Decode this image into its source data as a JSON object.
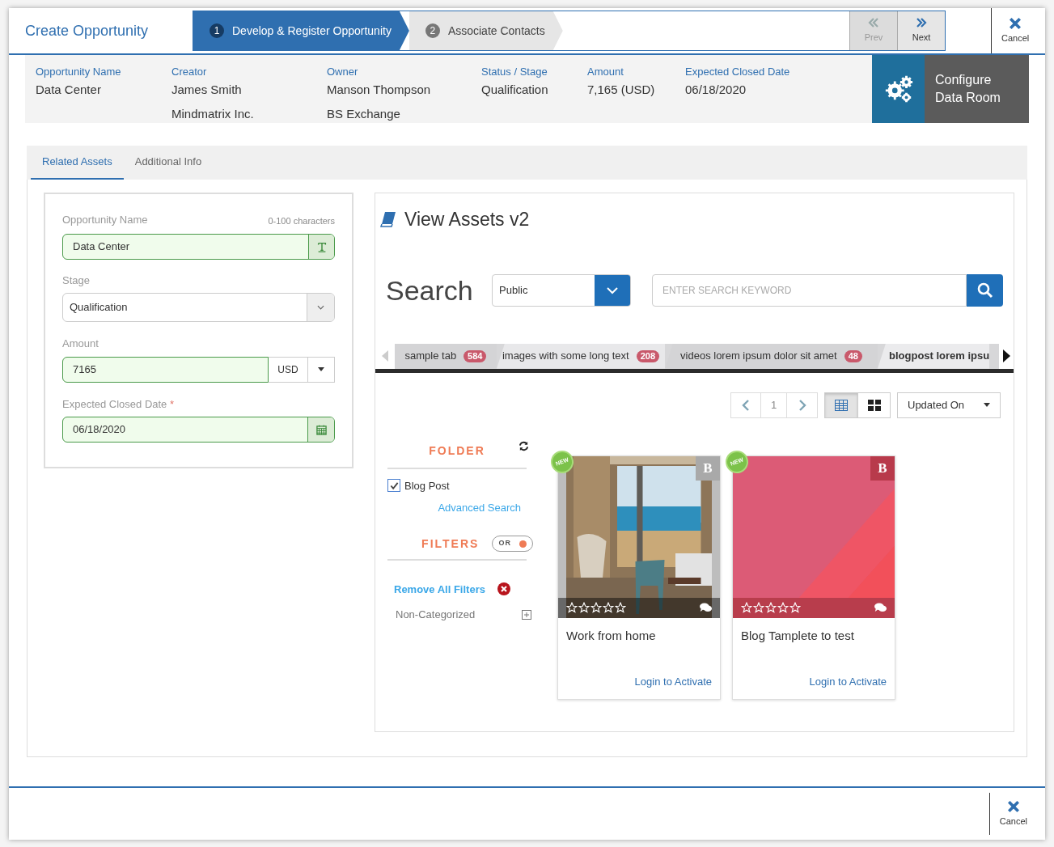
{
  "header": {
    "title": "Create Opportunity",
    "steps": [
      {
        "number": "1",
        "label": "Develop & Register Opportunity",
        "selected": true
      },
      {
        "number": "2",
        "label": "Associate Contacts",
        "selected": false
      }
    ],
    "nav": [
      {
        "kind": "prev",
        "label": "Prev",
        "disabled": true
      },
      {
        "kind": "next",
        "label": "Next",
        "disabled": false
      }
    ],
    "cancel": "Cancel"
  },
  "summary": [
    {
      "label": "Opportunity Name",
      "values": [
        "Data Center"
      ]
    },
    {
      "label": "Creator",
      "values": [
        "James Smith",
        "Mindmatrix Inc."
      ]
    },
    {
      "label": "Owner",
      "values": [
        "Manson Thompson",
        "BS Exchange"
      ]
    },
    {
      "label": "Status / Stage",
      "values": [
        "Qualification"
      ]
    },
    {
      "label": "Amount",
      "values": [
        "7,165 (USD)"
      ]
    },
    {
      "label": "Expected Closed Date",
      "values": [
        "06/18/2020"
      ]
    }
  ],
  "configure_button": {
    "label_lines": [
      "Configure",
      "Data Room"
    ]
  },
  "tabs": [
    {
      "label": "Related Assets",
      "selected": true
    },
    {
      "label": "Additional Info",
      "selected": false
    }
  ],
  "form": {
    "name": {
      "label": "Opportunity Name",
      "hint": "0-100 characters",
      "value": "Data Center"
    },
    "stage": {
      "label": "Stage",
      "value": "Qualification"
    },
    "amount": {
      "label": "Amount",
      "value": "7165",
      "currency": "USD"
    },
    "date": {
      "label": "Expected Closed Date",
      "required_mark": "*",
      "value": "06/18/2020"
    }
  },
  "assets": {
    "title": "View Assets v2",
    "search_label": "Search",
    "scope": "Public",
    "search_placeholder": "ENTER SEARCH KEYWORD",
    "asset_tabs": [
      {
        "label": "sample tab",
        "count": "584",
        "selected": false
      },
      {
        "label": "images with some long text",
        "count": "208",
        "selected": false
      },
      {
        "label": "videos lorem ipsum dolor sit amet",
        "count": "48",
        "selected": false
      },
      {
        "label": "blogpost lorem ipsu",
        "selected": true
      }
    ],
    "page": "1",
    "view_modes": [
      {
        "kind": "list",
        "selected": true
      },
      {
        "kind": "grid",
        "selected": false
      }
    ],
    "sort": "Updated On",
    "folder_title": "FOLDER",
    "folders": [
      {
        "label": "Blog Post",
        "checked": true
      }
    ],
    "advanced_search": "Advanced Search",
    "filters_title": "FILTERS",
    "filter_mode": {
      "label": "OR",
      "on": true
    },
    "remove_filters": "Remove All Filters",
    "categories": [
      "Non-Categorized"
    ],
    "cards": [
      {
        "badge": "NEW",
        "type_letter": "B",
        "stars": 0,
        "title": "Work from home",
        "action": "Login to Activate"
      },
      {
        "kind": "pink",
        "badge": "NEW",
        "type_letter": "B",
        "stars": 0,
        "title": "Blog Tamplete to test",
        "action": "Login to Activate"
      }
    ]
  },
  "footer": {
    "cancel": "Cancel"
  }
}
